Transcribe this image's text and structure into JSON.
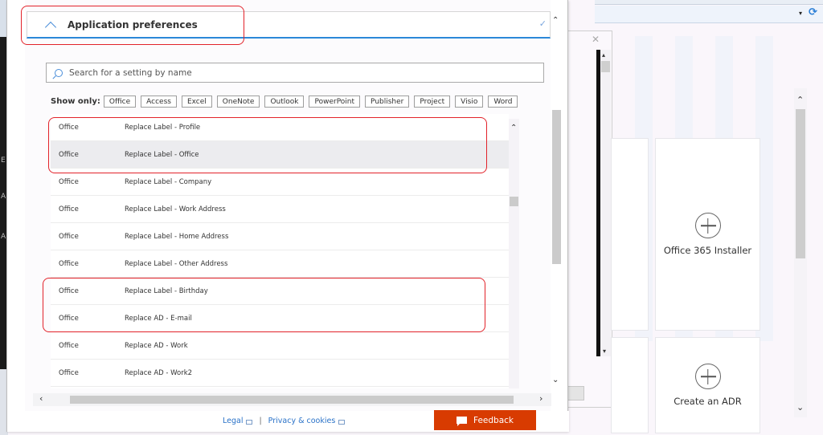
{
  "background_app": {
    "tiles": [
      {
        "label": "Office 365 Installer",
        "icon": "plus-circle-icon"
      },
      {
        "label": "Create an ADR",
        "icon": "plus-circle-icon"
      }
    ],
    "address_bar": {
      "dropdown_icon": "▾",
      "refresh_icon": "⟳"
    }
  },
  "dialog": {
    "section": {
      "title": "Application preferences",
      "expanded": true,
      "chevron_icon": "chevron-up-icon",
      "status_icon": "✓"
    },
    "search": {
      "placeholder": "Search for a setting by name",
      "value": ""
    },
    "filter": {
      "label": "Show only:",
      "options": [
        "Office",
        "Access",
        "Excel",
        "OneNote",
        "Outlook",
        "PowerPoint",
        "Publisher",
        "Project",
        "Visio",
        "Word"
      ]
    },
    "settings_list": {
      "rows": [
        {
          "app": "Office",
          "setting": "Replace Label - Profile",
          "selected": false
        },
        {
          "app": "Office",
          "setting": "Replace Label - Office",
          "selected": true
        },
        {
          "app": "Office",
          "setting": "Replace Label - Company",
          "selected": false
        },
        {
          "app": "Office",
          "setting": "Replace Label - Work Address",
          "selected": false
        },
        {
          "app": "Office",
          "setting": "Replace Label - Home Address",
          "selected": false
        },
        {
          "app": "Office",
          "setting": "Replace Label - Other Address",
          "selected": false
        },
        {
          "app": "Office",
          "setting": "Replace Label - Birthday",
          "selected": false
        },
        {
          "app": "Office",
          "setting": "Replace AD - E-mail",
          "selected": false
        },
        {
          "app": "Office",
          "setting": "Replace AD - Work",
          "selected": false
        },
        {
          "app": "Office",
          "setting": "Replace AD - Work2",
          "selected": false
        }
      ]
    },
    "scroll_glyphs": {
      "up": "⌃",
      "down": "⌄",
      "left": "‹",
      "right": "›"
    },
    "footer": {
      "legal": "Legal",
      "separator": "|",
      "privacy": "Privacy & cookies",
      "feedback": "Feedback"
    }
  },
  "colors": {
    "accent_blue": "#2b88d8",
    "highlight_red": "#e2222a",
    "feedback_orange": "#d83b01",
    "link_blue": "#2a72c8"
  }
}
